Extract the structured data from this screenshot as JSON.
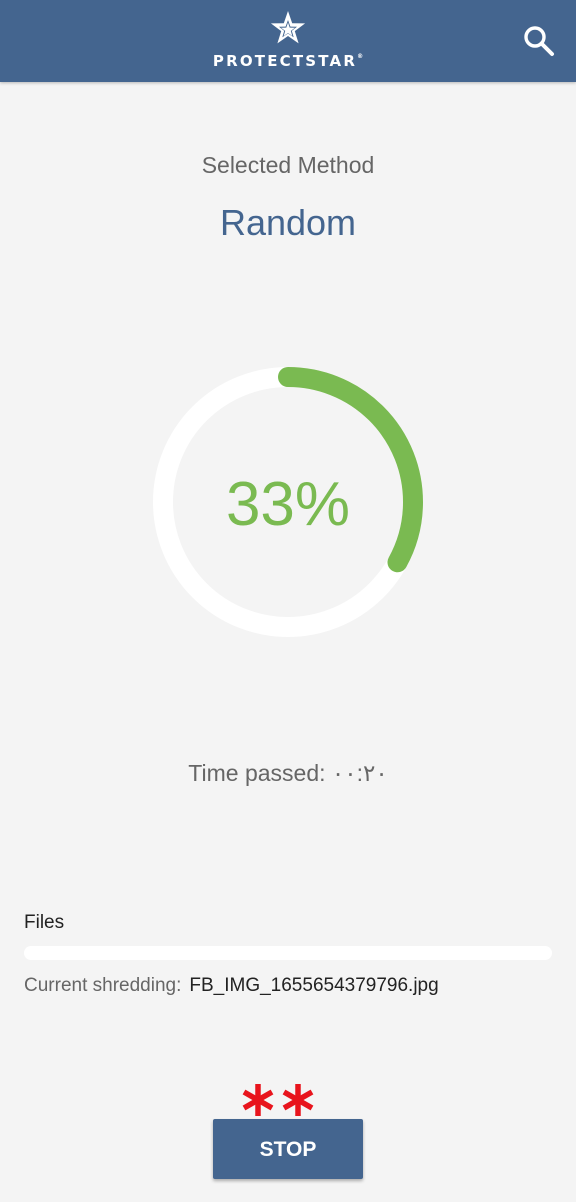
{
  "app_bar": {
    "brand": "PROTECTSTAR",
    "brand_mark": "®",
    "logo_icon": "star-icon",
    "search_icon": "search-icon"
  },
  "method": {
    "caption": "Selected Method",
    "value": "Random"
  },
  "progress": {
    "percent_label": "33%",
    "fraction": 0.33
  },
  "time": {
    "label": "Time passed:",
    "value": "۰۰:۲۰"
  },
  "files": {
    "label": "Files",
    "progress_fraction": 0,
    "current_label": "Current shredding:",
    "current_file": "FB_IMG_1655654379796.jpg"
  },
  "annotation": {
    "text": "**"
  },
  "actions": {
    "stop_label": "STOP"
  },
  "colors": {
    "primary": "#44658f",
    "accent_green": "#7aba51",
    "ring_track": "#ffffff",
    "annotation_red": "#e8141c",
    "background": "#f4f4f4"
  }
}
